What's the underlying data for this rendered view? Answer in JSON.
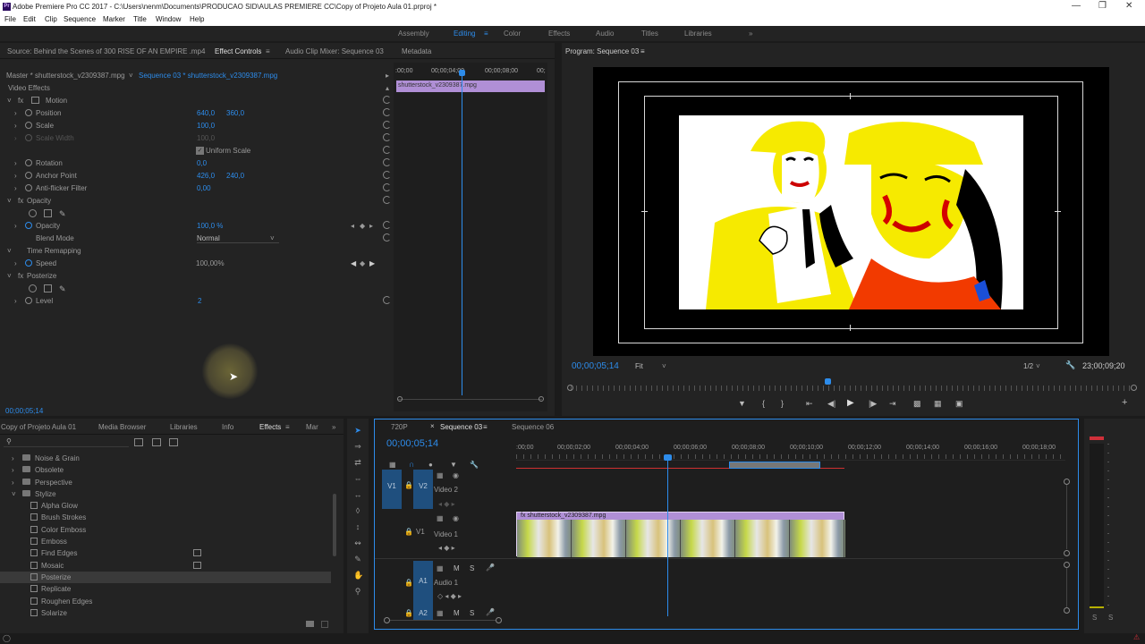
{
  "window": {
    "title": "Adobe Premiere Pro CC 2017 - C:\\Users\\nenm\\Documents\\PRODUCAO SID\\AULAS PREMIERE CC\\Copy of Projeto Aula 01.prproj *",
    "app_icon": "Pr"
  },
  "menu": [
    "File",
    "Edit",
    "Clip",
    "Sequence",
    "Marker",
    "Title",
    "Window",
    "Help"
  ],
  "workspaces": [
    "Assembly",
    "Editing",
    "Color",
    "Effects",
    "Audio",
    "Titles",
    "Libraries"
  ],
  "ec": {
    "tabs": [
      "Source: Behind the Scenes of 300 RISE OF AN EMPIRE .mp4",
      "Effect Controls",
      "Audio Clip Mixer: Sequence 03",
      "Metadata"
    ],
    "master": "Master * shutterstock_v2309387.mpg",
    "sequence": "Sequence 03 * shutterstock_v2309387.mpg",
    "section": "Video Effects",
    "motion": "Motion",
    "position": "Position",
    "pos_x": "640,0",
    "pos_y": "360,0",
    "scale": "Scale",
    "scale_val": "100,0",
    "scale_width": "Scale Width",
    "scale_width_val": "100,0",
    "uniform": "Uniform Scale",
    "rotation": "Rotation",
    "rotation_val": "0,0",
    "anchor": "Anchor Point",
    "anchor_x": "426,0",
    "anchor_y": "240,0",
    "antiflicker": "Anti-flicker Filter",
    "antiflicker_val": "0,00",
    "opacity": "Opacity",
    "opacity_prop": "Opacity",
    "opacity_val": "100,0 %",
    "blend": "Blend Mode",
    "blend_val": "Normal",
    "timeremap": "Time Remapping",
    "speed": "Speed",
    "speed_val": "100,00%",
    "posterize": "Posterize",
    "level": "Level",
    "level_val": "2",
    "timecode": "00;00;05;14",
    "mini_ruler": [
      ":00;00",
      "00;00;04;00",
      "00;00;08;00",
      "00;"
    ],
    "mini_clip": "shutterstock_v2309387.mpg"
  },
  "pm": {
    "title": "Program: Sequence 03",
    "timecode": "00;00;05;14",
    "fit": "Fit",
    "res": "1/2",
    "duration": "23;00;09;20"
  },
  "bin": {
    "tabs": [
      "Copy of Projeto Aula 01",
      "Media Browser",
      "Libraries",
      "Info",
      "Effects",
      "Mar"
    ],
    "items": [
      {
        "label": "Noise & Grain",
        "type": "folder"
      },
      {
        "label": "Obsolete",
        "type": "folder"
      },
      {
        "label": "Perspective",
        "type": "folder"
      },
      {
        "label": "Stylize",
        "type": "folder-open"
      },
      {
        "label": "Alpha Glow",
        "type": "fx"
      },
      {
        "label": "Brush Strokes",
        "type": "fx"
      },
      {
        "label": "Color Emboss",
        "type": "fx"
      },
      {
        "label": "Emboss",
        "type": "fx"
      },
      {
        "label": "Find Edges",
        "type": "fx"
      },
      {
        "label": "Mosaic",
        "type": "fx"
      },
      {
        "label": "Posterize",
        "type": "fx"
      },
      {
        "label": "Replicate",
        "type": "fx"
      },
      {
        "label": "Roughen Edges",
        "type": "fx"
      },
      {
        "label": "Solarize",
        "type": "fx"
      }
    ]
  },
  "timeline": {
    "tabs": [
      "720P",
      "Sequence 03",
      "Sequence 06"
    ],
    "timecode": "00;00;05;14",
    "ruler": [
      ":00;00",
      "00;00;02;00",
      "00;00;04;00",
      "00;00;06;00",
      "00;00;08;00",
      "00;00;10;00",
      "00;00;12;00",
      "00;00;14;00",
      "00;00;16;00",
      "00;00;18;00"
    ],
    "v2": "V2",
    "v2_name": "Video 2",
    "v1": "V1",
    "v1_name": "Video 1",
    "a1": "A1",
    "a1_name": "Audio 1",
    "a2": "A2",
    "src_v1": "V1",
    "src_a1": "A1",
    "clip": "shutterstock_v2309387.mpg"
  },
  "audio_meter": {
    "labels": [
      "S",
      "S"
    ]
  },
  "colors": {
    "accent": "#2d8ceb",
    "clip": "#b08fd6"
  }
}
